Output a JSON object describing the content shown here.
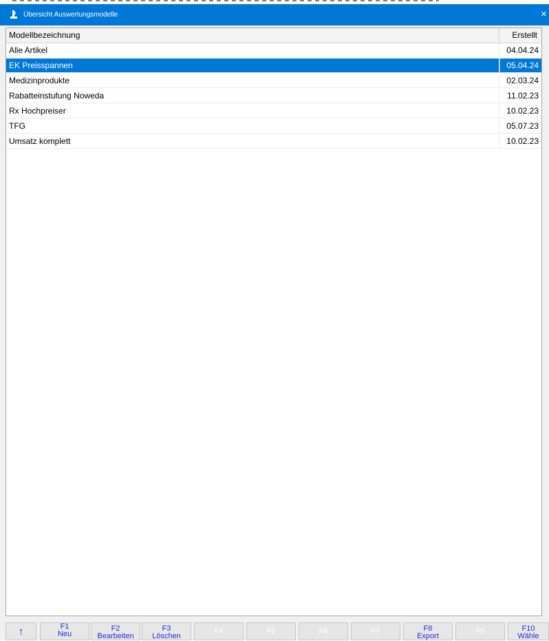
{
  "window": {
    "title": "Übersicht Auswertungsmodelle",
    "close": "×"
  },
  "table": {
    "headers": [
      "Modellbezeichnung",
      "Erstellt"
    ],
    "rows": [
      {
        "name": "Alle Artikel",
        "date": "04.04.24",
        "selected": false
      },
      {
        "name": "EK Preisspannen",
        "date": "05.04.24",
        "selected": true
      },
      {
        "name": "Medizinprodukte",
        "date": "02.03.24",
        "selected": false
      },
      {
        "name": "Rabatteinstufung Noweda",
        "date": "11.02.23",
        "selected": false
      },
      {
        "name": "Rx Hochpreiser",
        "date": "10.02.23",
        "selected": false
      },
      {
        "name": "TFG",
        "date": "05.07.23",
        "selected": false
      },
      {
        "name": "Umsatz komplett",
        "date": "10.02.23",
        "selected": false
      }
    ]
  },
  "function_keys": [
    {
      "key": "↑",
      "label": "",
      "enabled": true,
      "icon": "up-arrow-icon"
    },
    {
      "key": "F1",
      "label": "Neu",
      "enabled": true,
      "highlight": true
    },
    {
      "key": "F2",
      "label": "Bearbeiten",
      "enabled": true
    },
    {
      "key": "F3",
      "label": "Löschen",
      "enabled": true
    },
    {
      "key": "F4",
      "label": "",
      "enabled": false
    },
    {
      "key": "F5",
      "label": "",
      "enabled": false
    },
    {
      "key": "F6",
      "label": "",
      "enabled": false
    },
    {
      "key": "F7",
      "label": "",
      "enabled": false
    },
    {
      "key": "F8",
      "label": "Export",
      "enabled": true
    },
    {
      "key": "F9",
      "label": "",
      "enabled": false
    },
    {
      "key": "F10",
      "label": "Wähle",
      "enabled": true
    }
  ],
  "colors": {
    "titlebar": "#0078d7",
    "selection": "#0078d7",
    "fkey_text": "#2a2ad0",
    "highlight": "#ffff33"
  }
}
